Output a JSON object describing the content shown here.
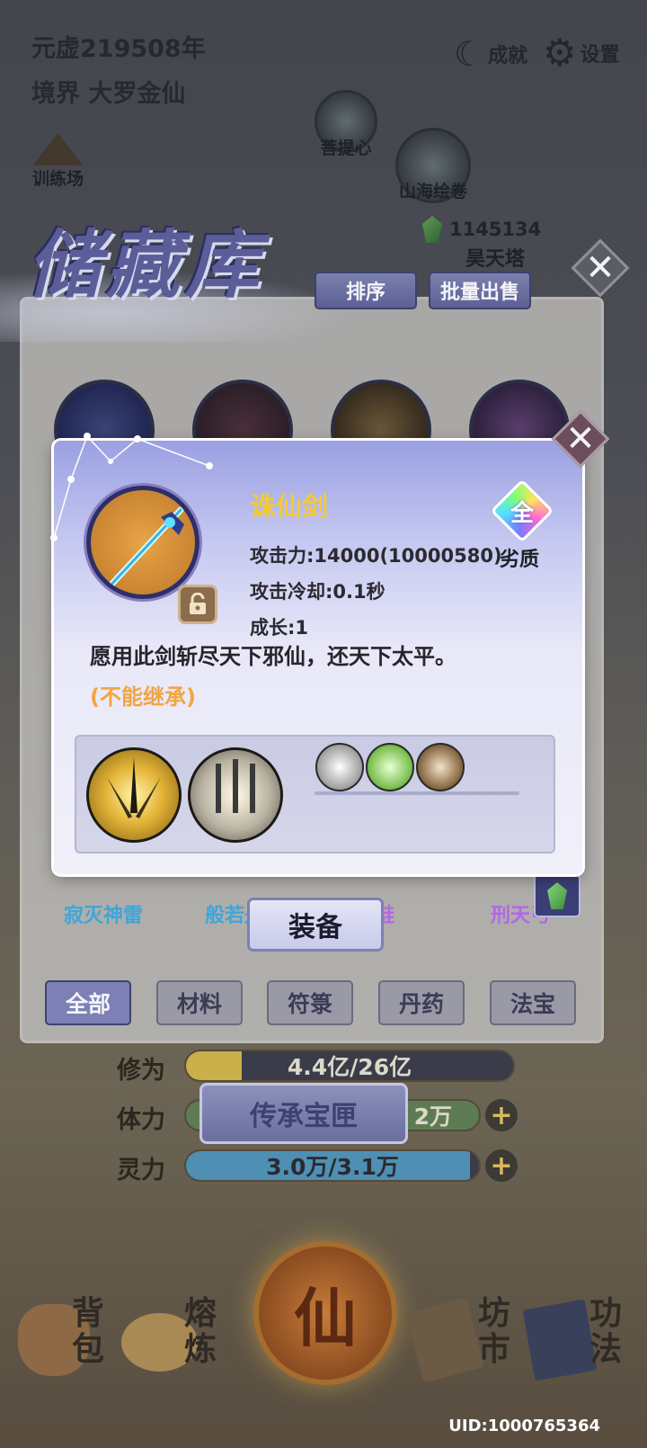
{
  "header": {
    "era": "元虚219508年",
    "realm_prefix": "境界",
    "realm": "大罗金仙",
    "achievements": "成就",
    "settings": "设置",
    "training": "训练场",
    "bodhi": "菩提心",
    "scroll": "山海绘卷",
    "tower": "昊天塔",
    "spirit_stones": "1145134"
  },
  "storage": {
    "title": "储藏库",
    "sort_button": "排序",
    "bulk_sell_button": "批量出售",
    "visible_item_names": [
      "寂灭神雷",
      "般若舟",
      "靴鞋",
      "刑天弓"
    ],
    "tabs": [
      {
        "label": "全部",
        "active": true
      },
      {
        "label": "材料",
        "active": false
      },
      {
        "label": "符箓",
        "active": false
      },
      {
        "label": "丹药",
        "active": false
      },
      {
        "label": "法宝",
        "active": false
      }
    ]
  },
  "stats": {
    "cultivation": {
      "label": "修为",
      "value": "4.4亿/26亿",
      "fill": 0.17
    },
    "stamina": {
      "label": "体力",
      "value": "2万"
    },
    "spirit": {
      "label": "灵力",
      "value": "3.0万/3.1万",
      "fill": 0.97
    },
    "legacy_button": "传承宝匣"
  },
  "nav": {
    "bag": [
      "背",
      "包"
    ],
    "smelt": [
      "熔",
      "炼"
    ],
    "center": "仙",
    "market": [
      "坊",
      "市"
    ],
    "skills": [
      "功",
      "法"
    ]
  },
  "uid": "UID:1000765364",
  "dialog": {
    "name": "诛仙剑",
    "attack": "攻击力:14000(10000580)",
    "cooldown": "攻击冷却:0.1秒",
    "growth": "成长:1",
    "quality_char": "全",
    "quality_label": "劣质",
    "description": "愿用此剑斩尽天下邪仙，还天下太平。",
    "inherit_note": "(不能继承)",
    "equip_button": "装备",
    "colors": {
      "name": "#f2ca33",
      "inherit": "#f2a541",
      "accent": "#7c80b4"
    }
  }
}
